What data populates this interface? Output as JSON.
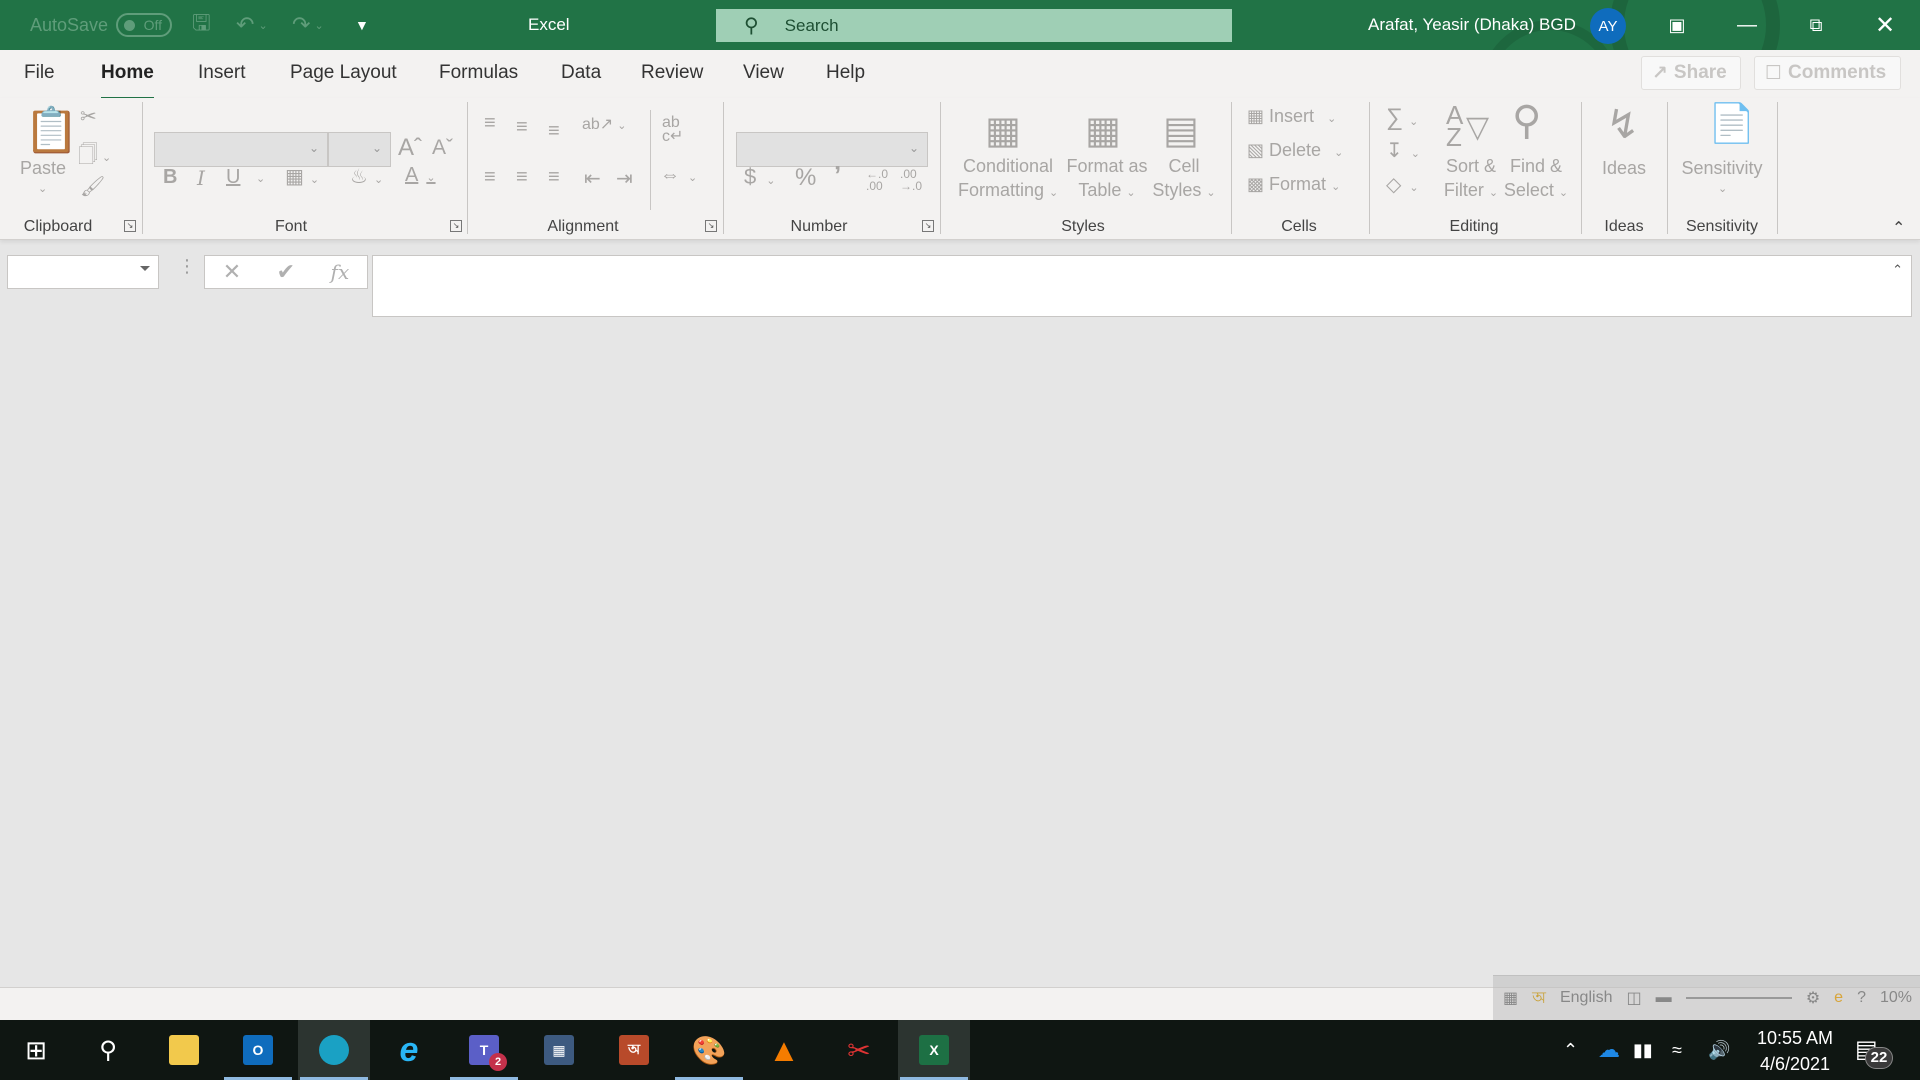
{
  "titlebar": {
    "autosave_label": "AutoSave",
    "autosave_state": "Off",
    "app_title": "Excel",
    "search_placeholder": "Search",
    "user_name": "Arafat, Yeasir (Dhaka) BGD",
    "user_initials": "AY",
    "colors": {
      "brand": "#217346",
      "search_bg": "#9fcfb5",
      "avatar_bg": "#0f6cbd"
    }
  },
  "tabs": [
    {
      "label": "File"
    },
    {
      "label": "Home",
      "active": true
    },
    {
      "label": "Insert"
    },
    {
      "label": "Page Layout"
    },
    {
      "label": "Formulas"
    },
    {
      "label": "Data"
    },
    {
      "label": "Review"
    },
    {
      "label": "View"
    },
    {
      "label": "Help"
    }
  ],
  "header_buttons": {
    "share": "Share",
    "comments": "Comments"
  },
  "ribbon": {
    "groups": {
      "clipboard": "Clipboard",
      "font": "Font",
      "alignment": "Alignment",
      "number": "Number",
      "styles": "Styles",
      "cells": "Cells",
      "editing": "Editing",
      "ideas": "Ideas",
      "sensitivity": "Sensitivity"
    },
    "paste": "Paste",
    "bold": "B",
    "italic": "I",
    "underline": "U",
    "grow_font": "Aˆ",
    "shrink_font": "Aˇ",
    "currency": "$",
    "percent": "%",
    "comma": "’",
    "inc_decimal": "←.0 .00",
    "dec_decimal": ".00 →.0",
    "conditional_formatting": [
      "Conditional",
      "Formatting"
    ],
    "format_as_table": [
      "Format as",
      "Table"
    ],
    "cell_styles": [
      "Cell",
      "Styles"
    ],
    "insert": "Insert",
    "delete": "Delete",
    "format": "Format",
    "sort_filter": [
      "Sort &",
      "Filter"
    ],
    "find_select": [
      "Find &",
      "Select"
    ],
    "ideas": "Ideas",
    "sensitivity": "Sensitivity",
    "font_name_value": "",
    "font_size_value": "",
    "number_format_value": ""
  },
  "formula_bar": {
    "name_box_value": "",
    "formula_value": "",
    "cancel_icon": "✕",
    "enter_icon": "✔",
    "fx_label": "fx"
  },
  "ime_bar": {
    "language": "English",
    "zoom": "10%"
  },
  "taskbar": {
    "apps": [
      {
        "name": "start"
      },
      {
        "name": "search"
      },
      {
        "name": "file-explorer"
      },
      {
        "name": "outlook",
        "running": true
      },
      {
        "name": "edge",
        "running": true,
        "active": true
      },
      {
        "name": "internet-explorer"
      },
      {
        "name": "teams",
        "running": true,
        "badge": "2"
      },
      {
        "name": "calculator"
      },
      {
        "name": "bangla-keyboard"
      },
      {
        "name": "paint",
        "running": true
      },
      {
        "name": "vlc"
      },
      {
        "name": "snipping-tool"
      },
      {
        "name": "excel",
        "running": true,
        "active": true
      }
    ],
    "time": "10:55 AM",
    "date": "4/6/2021",
    "notification_count": "22"
  }
}
